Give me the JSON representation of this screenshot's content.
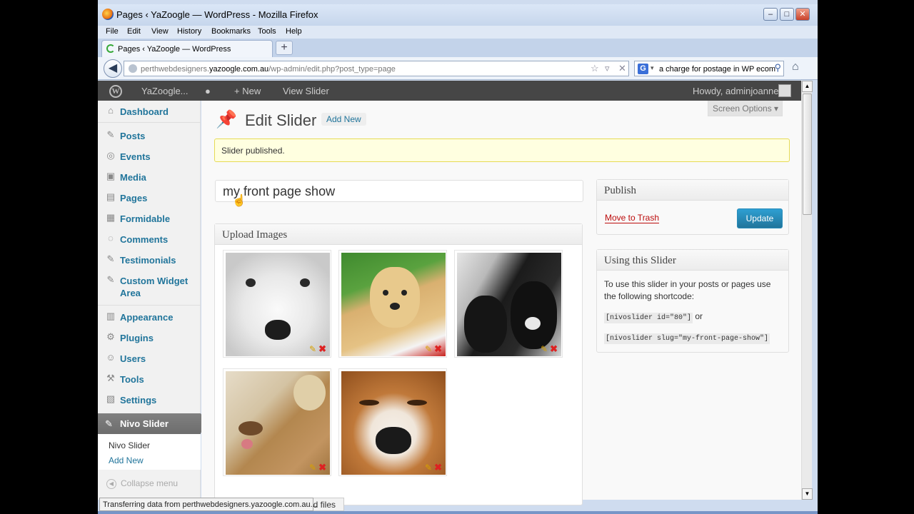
{
  "browser": {
    "window_title": "Pages ‹ YaZoogle — WordPress - Mozilla Firefox",
    "menu": [
      "File",
      "Edit",
      "View",
      "History",
      "Bookmarks",
      "Tools",
      "Help"
    ],
    "tab_title": "Pages ‹ YaZoogle — WordPress",
    "url_prefix": "perthwebdesigners.",
    "url_host": "yazoogle.com.au",
    "url_path": "/wp-admin/edit.php?post_type=page",
    "search_engine": "G",
    "search_value": "a charge for postage in WP ecom",
    "status_text": "Transferring data from perthwebdesigners.yazoogle.com.au...",
    "status_partial": "ad files"
  },
  "adminbar": {
    "site_name": "YaZoogle...",
    "new_label": "+ New",
    "view_label": "View Slider",
    "howdy": "Howdy, adminjoanne"
  },
  "sidebar": {
    "items": [
      {
        "label": "Dashboard",
        "icon": "dashboard-icon",
        "glyph": "⌂"
      },
      {
        "label": "Posts",
        "icon": "pin-icon",
        "glyph": "✎"
      },
      {
        "label": "Events",
        "icon": "events-icon",
        "glyph": "◎"
      },
      {
        "label": "Media",
        "icon": "media-icon",
        "glyph": "▣"
      },
      {
        "label": "Pages",
        "icon": "pages-icon",
        "glyph": "▤"
      },
      {
        "label": "Formidable",
        "icon": "formidable-icon",
        "glyph": "▦"
      },
      {
        "label": "Comments",
        "icon": "comments-icon",
        "glyph": "◌"
      },
      {
        "label": "Testimonials",
        "icon": "pin-icon",
        "glyph": "✎"
      },
      {
        "label": "Custom Widget Area",
        "icon": "pin-icon",
        "glyph": "✎"
      },
      {
        "label": "Appearance",
        "icon": "appearance-icon",
        "glyph": "▥"
      },
      {
        "label": "Plugins",
        "icon": "plugins-icon",
        "glyph": "⚙"
      },
      {
        "label": "Users",
        "icon": "users-icon",
        "glyph": "☺"
      },
      {
        "label": "Tools",
        "icon": "tools-icon",
        "glyph": "⚒"
      },
      {
        "label": "Settings",
        "icon": "settings-icon",
        "glyph": "▧"
      }
    ],
    "active": {
      "label": "Nivo Slider",
      "glyph": "✎"
    },
    "submenu": [
      "Nivo Slider",
      "Add New"
    ],
    "collapse": "Collapse menu"
  },
  "page": {
    "title": "Edit Slider",
    "add_new": "Add New",
    "screen_options": "Screen Options ▾",
    "notice": "Slider published.",
    "post_title": "my front page show",
    "upload_heading": "Upload Images"
  },
  "publish": {
    "heading": "Publish",
    "trash": "Move to Trash",
    "update": "Update"
  },
  "usage": {
    "heading": "Using this Slider",
    "text": "To use this slider in your posts or pages use the following shortcode:",
    "code_id": "[nivoslider id=\"80\"]",
    "or": "or",
    "code_slug": "[nivoslider slug=\"my-front-page-show\"]"
  }
}
